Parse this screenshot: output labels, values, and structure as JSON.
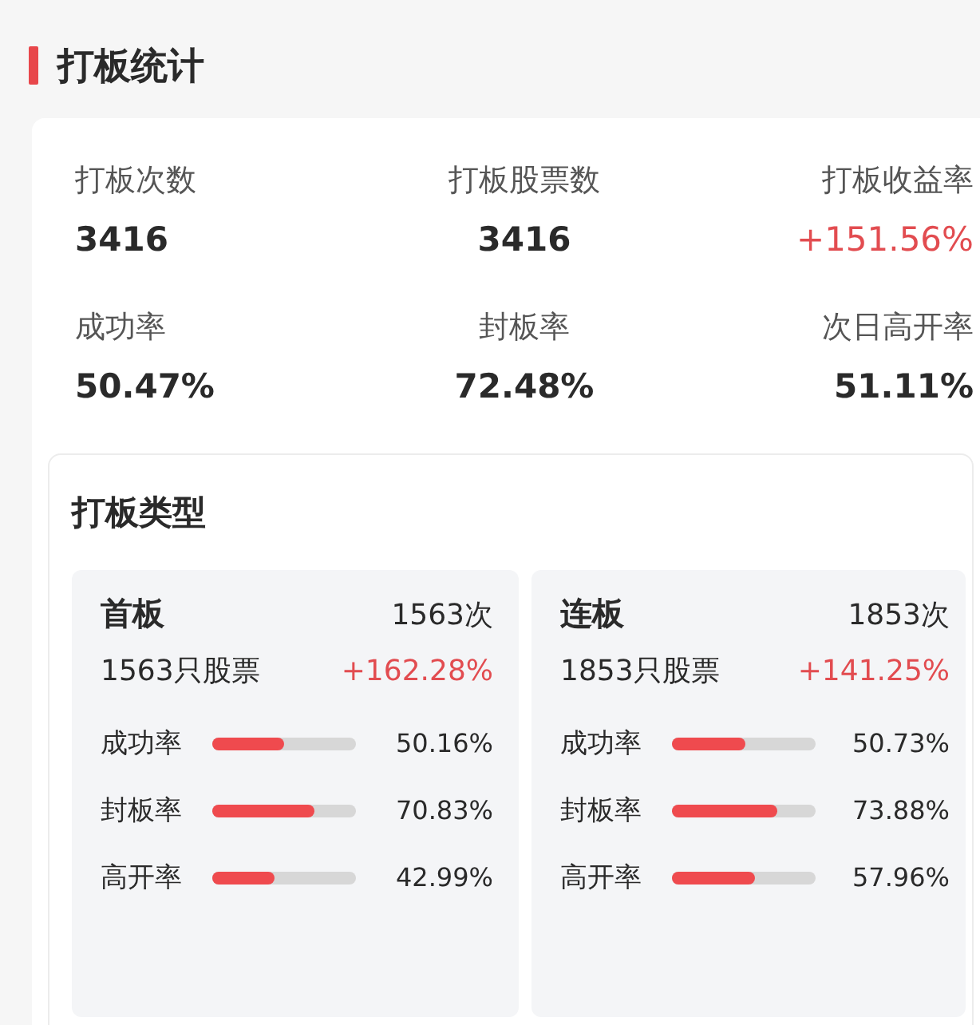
{
  "title": "打板统计",
  "stats": [
    {
      "label": "打板次数",
      "value": "3416",
      "kind": "plain"
    },
    {
      "label": "打板股票数",
      "value": "3416",
      "kind": "plain"
    },
    {
      "label": "打板收益率",
      "value": "+151.56%",
      "kind": "gain"
    },
    {
      "label": "成功率",
      "value": "50.47%",
      "kind": "plain"
    },
    {
      "label": "封板率",
      "value": "72.48%",
      "kind": "plain"
    },
    {
      "label": "次日高开率",
      "value": "51.11%",
      "kind": "plain"
    }
  ],
  "types": {
    "title": "打板类型",
    "cards": [
      {
        "name": "首板",
        "count": "1563次",
        "stocks": "1563只股票",
        "return": "+162.28%",
        "metrics": [
          {
            "label": "成功率",
            "level": 0.5016,
            "reading": "50.16%"
          },
          {
            "label": "封板率",
            "level": 0.7083,
            "reading": "70.83%"
          },
          {
            "label": "高开率",
            "level": 0.4299,
            "reading": "42.99%"
          }
        ]
      },
      {
        "name": "连板",
        "count": "1853次",
        "stocks": "1853只股票",
        "return": "+141.25%",
        "metrics": [
          {
            "label": "成功率",
            "level": 0.5073,
            "reading": "50.73%"
          },
          {
            "label": "封板率",
            "level": 0.7388,
            "reading": "73.88%"
          },
          {
            "label": "高开率",
            "level": 0.5796,
            "reading": "57.96%"
          }
        ]
      }
    ]
  }
}
